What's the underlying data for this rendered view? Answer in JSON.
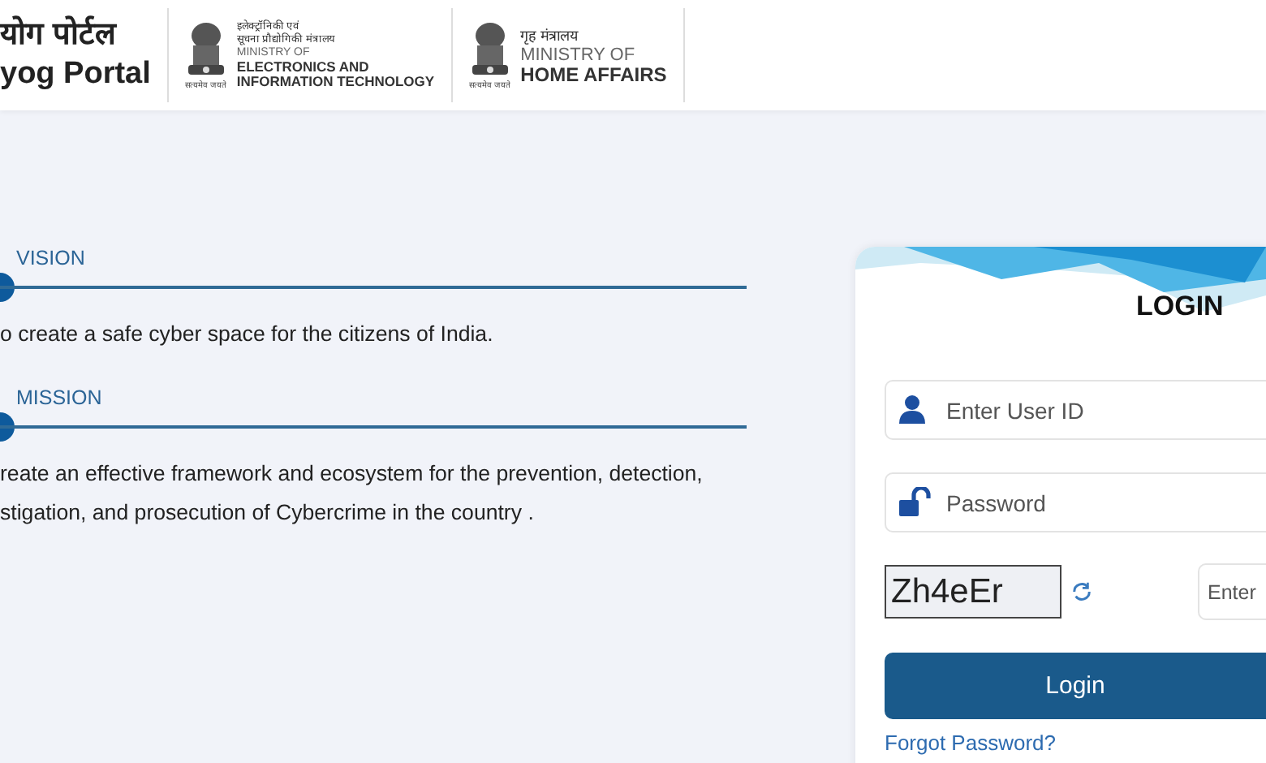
{
  "header": {
    "portal_title": [
      "योग पोर्टल",
      "yog Portal"
    ],
    "ministries": [
      {
        "motto": "सत्यमेव जयते",
        "lines": [
          {
            "kind": "hindi",
            "text": "इलेक्ट्रॉनिकी एवं"
          },
          {
            "kind": "hindi",
            "text": "सूचना प्रौद्योगिकी मंत्रालय"
          },
          {
            "kind": "light",
            "text": "MINISTRY OF"
          },
          {
            "kind": "bold",
            "text": "ELECTRONICS AND"
          },
          {
            "kind": "bold",
            "text": "INFORMATION TECHNOLOGY"
          }
        ]
      },
      {
        "motto": "सत्यमेव जयते",
        "lines": [
          {
            "kind": "hindi-large",
            "text": "गृह मंत्रालय"
          },
          {
            "kind": "light-large",
            "text": "MINISTRY OF"
          },
          {
            "kind": "bold-large",
            "text": "HOME AFFAIRS"
          }
        ]
      }
    ]
  },
  "sections": [
    {
      "heading": "VISION",
      "lines": [
        "o create a safe cyber space for the citizens of India."
      ]
    },
    {
      "heading": "MISSION",
      "lines": [
        "reate an effective framework and ecosystem for the prevention, detection,",
        "stigation, and prosecution of Cybercrime in the country ."
      ]
    }
  ],
  "login": {
    "title": "LOGIN",
    "user_id": {
      "placeholder": "Enter User ID"
    },
    "password": {
      "placeholder": "Password"
    },
    "captcha": {
      "code": "Zh4eEr",
      "placeholder": "Enter"
    },
    "button": "Login",
    "forgot_link": "Forgot Password?"
  }
}
